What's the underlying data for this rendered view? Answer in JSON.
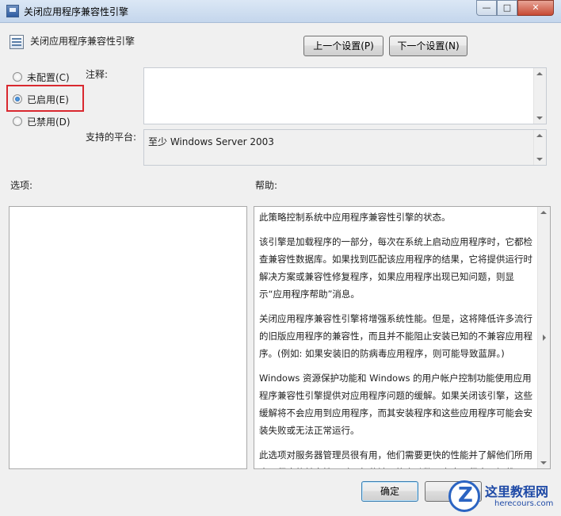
{
  "window": {
    "title": "关闭应用程序兼容性引擎",
    "controls": {
      "minimize": "—",
      "maximize": "□",
      "close": "✕"
    }
  },
  "header": {
    "policy_name": "关闭应用程序兼容性引擎",
    "icon": "policy-setting-icon",
    "prev_button": "上一个设置(P)",
    "next_button": "下一个设置(N)"
  },
  "options": {
    "not_configured": "未配置(C)",
    "enabled": "已启用(E)",
    "disabled": "已禁用(D)",
    "selected": "enabled"
  },
  "comment": {
    "label": "注释:",
    "value": ""
  },
  "platform": {
    "label": "支持的平台:",
    "value": "至少 Windows Server 2003"
  },
  "options_panel": {
    "label": "选项:"
  },
  "help": {
    "label": "帮助:",
    "paragraphs": [
      "此策略控制系统中应用程序兼容性引擎的状态。",
      "该引擎是加载程序的一部分，每次在系统上启动应用程序时，它都检查兼容性数据库。如果找到匹配该应用程序的结果，它将提供运行时解决方案或兼容性修复程序，如果应用程序出现已知问题，则显示“应用程序帮助”消息。",
      "关闭应用程序兼容性引擎将增强系统性能。但是，这将降低许多流行的旧版应用程序的兼容性，而且并不能阻止安装已知的不兼容应用程序。(例如: 如果安装旧的防病毒应用程序，则可能导致蓝屏。)",
      "Windows 资源保护功能和 Windows 的用户帐户控制功能使用应用程序兼容性引擎提供对应用程序问题的缓解。如果关闭该引擎，这些缓解将不会应用到应用程序，而其安装程序和这些应用程序可能会安装失败或无法正常运行。",
      "此选项对服务器管理员很有用，他们需要更快的性能并了解他们所用应用程序的兼容性。对于每秒钟可能启动数百次应用程序且加载"
    ]
  },
  "footer": {
    "ok_button": "确定"
  },
  "watermark": {
    "text": "这里教程网",
    "url": "herecours.com"
  },
  "colors": {
    "highlight": "#d9282f",
    "accent": "#2b64c2"
  }
}
